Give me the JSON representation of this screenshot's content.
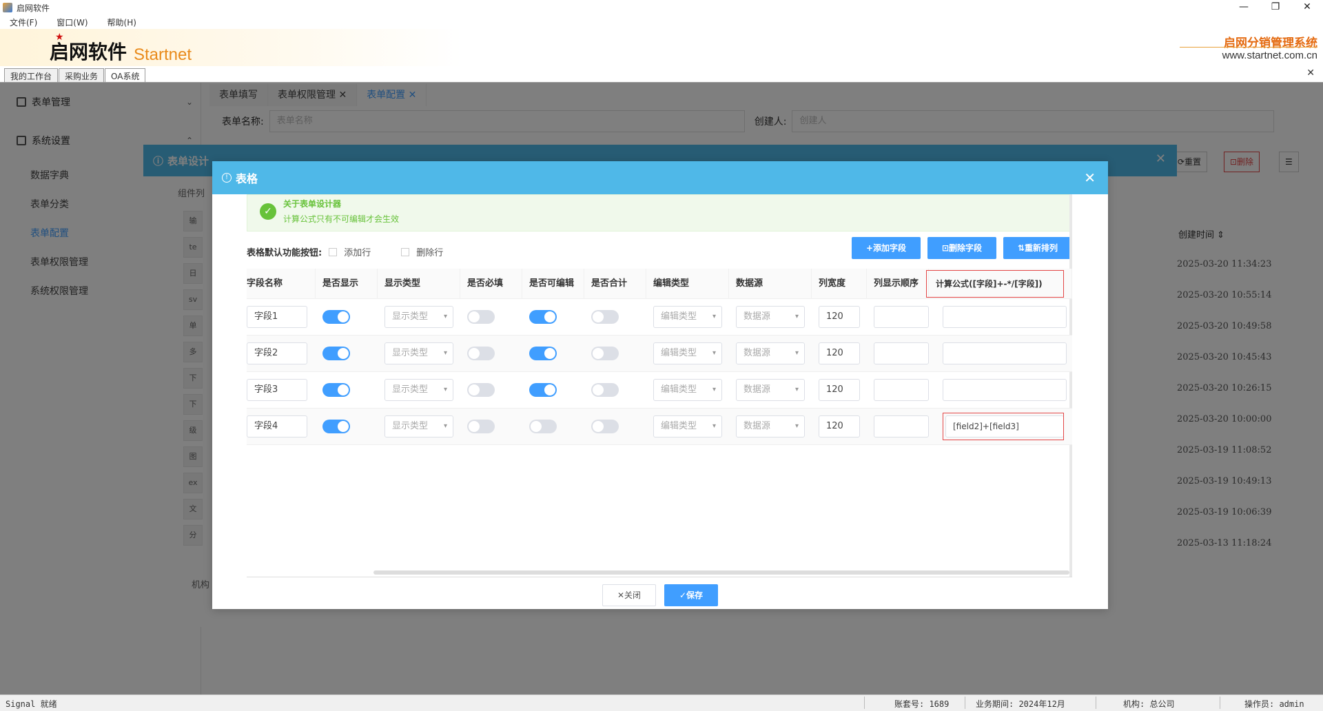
{
  "window": {
    "title": "启网软件",
    "minimize": "—",
    "maximize": "❐",
    "close": "✕"
  },
  "menu": [
    "文件(F)",
    "窗口(W)",
    "帮助(H)"
  ],
  "banner": {
    "logo_cn": "启网软件",
    "logo_en": "Startnet",
    "system_name": "启网分销管理系统",
    "website": "www.startnet.com.cn"
  },
  "top_tabs": [
    "我的工作台",
    "采购业务",
    "OA系统"
  ],
  "sidebar": {
    "groups": [
      {
        "label": "表单管理",
        "chevron": "⌄"
      },
      {
        "label": "系统设置",
        "chevron": "⌃"
      }
    ],
    "items": [
      "数据字典",
      "表单分类",
      "表单配置",
      "表单权限管理",
      "系统权限管理"
    ],
    "active_item": "表单配置"
  },
  "page_tabs": [
    {
      "label": "表单填写",
      "closable": false
    },
    {
      "label": "表单权限管理",
      "closable": true
    },
    {
      "label": "表单配置",
      "closable": true
    }
  ],
  "search": {
    "form_name_label": "表单名称:",
    "form_name_placeholder": "表单名称",
    "creator_label": "创建人:",
    "creator_placeholder": "创建人"
  },
  "background_list": {
    "right_buttons": [
      "⟳重置",
      "⊡删除",
      "☰"
    ],
    "header": "创建时间 ⇕",
    "timestamps": [
      "2025-03-20 11:34:23",
      "2025-03-20 10:55:14",
      "2025-03-20 10:49:58",
      "2025-03-20 10:45:43",
      "2025-03-20 10:26:15",
      "2025-03-20 10:00:00",
      "2025-03-19 11:08:52",
      "2025-03-19 10:49:13",
      "2025-03-19 10:06:39",
      "2025-03-13 11:18:24"
    ]
  },
  "outer_dialog": {
    "title": "表单设计",
    "component_list_label": "组件列",
    "org_label": "机构",
    "component_chips": [
      "输",
      "te",
      "日",
      "sv",
      "单",
      "多",
      "下",
      "下",
      "级",
      "图",
      "ex",
      "文",
      "分"
    ]
  },
  "dialog": {
    "title": "表格",
    "alert_title": "关于表单设计器",
    "alert_desc": "计算公式只有不可编辑才会生效",
    "func_label": "表格默认功能按钮:",
    "checkbox_add": "添加行",
    "checkbox_delete": "删除行",
    "btn_add_field": "+添加字段",
    "btn_del_field": "⊡删除字段",
    "btn_reorder": "⇅重新排列",
    "columns": [
      "字段名称",
      "是否显示",
      "显示类型",
      "是否必填",
      "是否可编辑",
      "是否合计",
      "编辑类型",
      "数据源",
      "列宽度",
      "列显示顺序",
      "计算公式([字段]+-*/[字段])"
    ],
    "rows": [
      {
        "name": "字段1",
        "show": true,
        "display_type": "显示类型",
        "required": false,
        "editable": true,
        "sum": false,
        "edit_type": "编辑类型",
        "datasource": "数据源",
        "width": "120",
        "order": "",
        "formula": ""
      },
      {
        "name": "字段2",
        "show": true,
        "display_type": "显示类型",
        "required": false,
        "editable": true,
        "sum": false,
        "edit_type": "编辑类型",
        "datasource": "数据源",
        "width": "120",
        "order": "",
        "formula": ""
      },
      {
        "name": "字段3",
        "show": true,
        "display_type": "显示类型",
        "required": false,
        "editable": true,
        "sum": false,
        "edit_type": "编辑类型",
        "datasource": "数据源",
        "width": "120",
        "order": "",
        "formula": ""
      },
      {
        "name": "字段4",
        "show": true,
        "display_type": "显示类型",
        "required": false,
        "editable": false,
        "sum": false,
        "edit_type": "编辑类型",
        "datasource": "数据源",
        "width": "120",
        "order": "",
        "formula": "[field2]+[field3]"
      }
    ],
    "btn_close": "✕关闭",
    "btn_save": "✓保存",
    "accent_color": "#409eff",
    "header_color": "#4fb8e8"
  },
  "statusbar": {
    "signal": "Signal 就绪",
    "account": "账套号: 1689",
    "period": "业务期间: 2024年12月",
    "org": "机构: 总公司",
    "operator": "操作员: admin"
  }
}
